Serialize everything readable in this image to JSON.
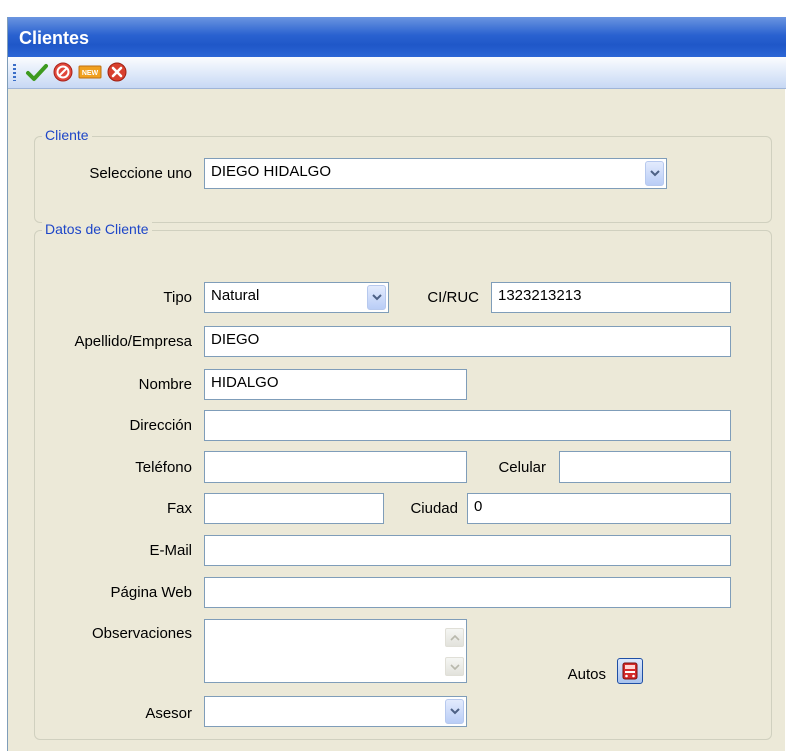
{
  "window": {
    "title": "Clientes"
  },
  "toolbar": {
    "buttons": [
      {
        "name": "accept",
        "icon": "check-icon"
      },
      {
        "name": "cancel",
        "icon": "no-entry-icon"
      },
      {
        "name": "new",
        "icon": "new-icon",
        "label": "NEW"
      },
      {
        "name": "close",
        "icon": "close-icon"
      }
    ]
  },
  "cliente_group": {
    "legend": "Cliente",
    "select_label": "Seleccione uno",
    "select_value": "DIEGO HIDALGO"
  },
  "datos_group": {
    "legend": "Datos de Cliente",
    "tipo_label": "Tipo",
    "tipo_value": "Natural",
    "ciruc_label": "CI/RUC",
    "ciruc_value": "1323213213",
    "apellido_label": "Apellido/Empresa",
    "apellido_value": "DIEGO",
    "nombre_label": "Nombre",
    "nombre_value": "HIDALGO",
    "direccion_label": "Dirección",
    "direccion_value": "",
    "telefono_label": "Teléfono",
    "telefono_value": "",
    "celular_label": "Celular",
    "celular_value": "",
    "fax_label": "Fax",
    "fax_value": "",
    "ciudad_label": "Ciudad",
    "ciudad_value": "0",
    "email_label": "E-Mail",
    "email_value": "",
    "web_label": "Página Web",
    "web_value": "",
    "observaciones_label": "Observaciones",
    "observaciones_value": "",
    "autos_label": "Autos",
    "asesor_label": "Asesor",
    "asesor_value": ""
  },
  "colors": {
    "titlebar": "#2a62d0",
    "window_bg": "#ece9d8",
    "legend_text": "#1e46c8",
    "field_border": "#7f9db9"
  }
}
